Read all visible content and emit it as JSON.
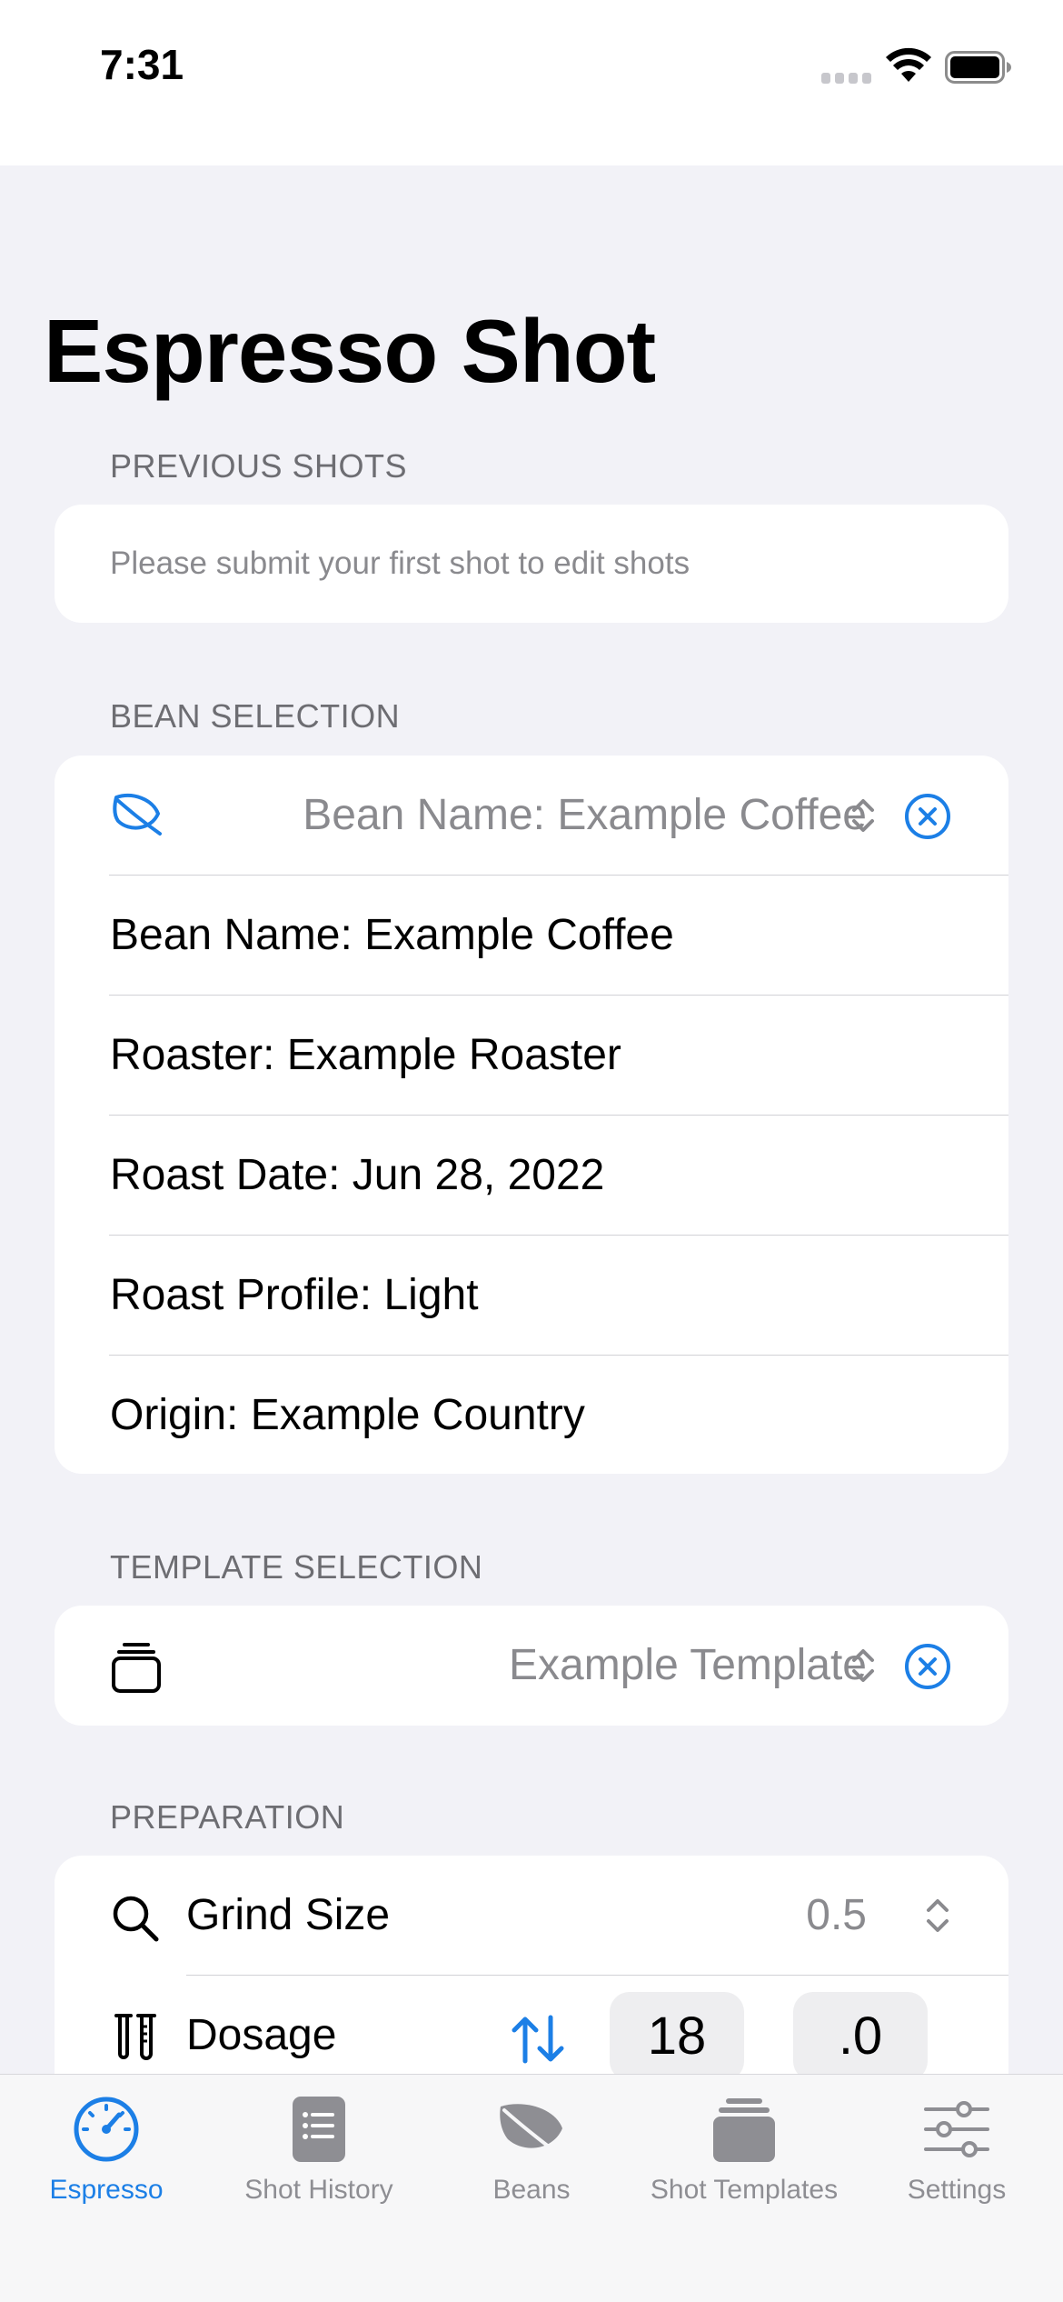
{
  "status_bar": {
    "time": "7:31"
  },
  "page": {
    "title": "Espresso Shot"
  },
  "sections": {
    "previous_shots": {
      "header": "PREVIOUS SHOTS",
      "placeholder": "Please submit your first shot to edit shots"
    },
    "bean_selection": {
      "header": "BEAN SELECTION",
      "picker_value": "Bean Name: Example Coffee",
      "details": [
        "Bean Name: Example Coffee",
        "Roaster: Example Roaster",
        "Roast Date: Jun 28, 2022",
        "Roast Profile: Light",
        "Origin: Example Country"
      ]
    },
    "template_selection": {
      "header": "TEMPLATE SELECTION",
      "picker_value": "Example Template"
    },
    "preparation": {
      "header": "PREPARATION",
      "grind_size": {
        "label": "Grind Size",
        "value": "0.5"
      },
      "dosage": {
        "label": "Dosage",
        "whole": "18",
        "decimal": ".0"
      }
    }
  },
  "tab_bar": {
    "active": "Espresso",
    "tabs": [
      {
        "label": "Espresso",
        "icon": "gauge-icon"
      },
      {
        "label": "Shot History",
        "icon": "list-icon"
      },
      {
        "label": "Beans",
        "icon": "leaf-icon"
      },
      {
        "label": "Shot Templates",
        "icon": "templates-icon"
      },
      {
        "label": "Settings",
        "icon": "sliders-icon"
      }
    ]
  },
  "colors": {
    "accent": "#1c7fe6",
    "background": "#f2f2f7",
    "card": "#ffffff",
    "secondary_text": "#8a8a8e",
    "section_header": "#6d6d72"
  }
}
